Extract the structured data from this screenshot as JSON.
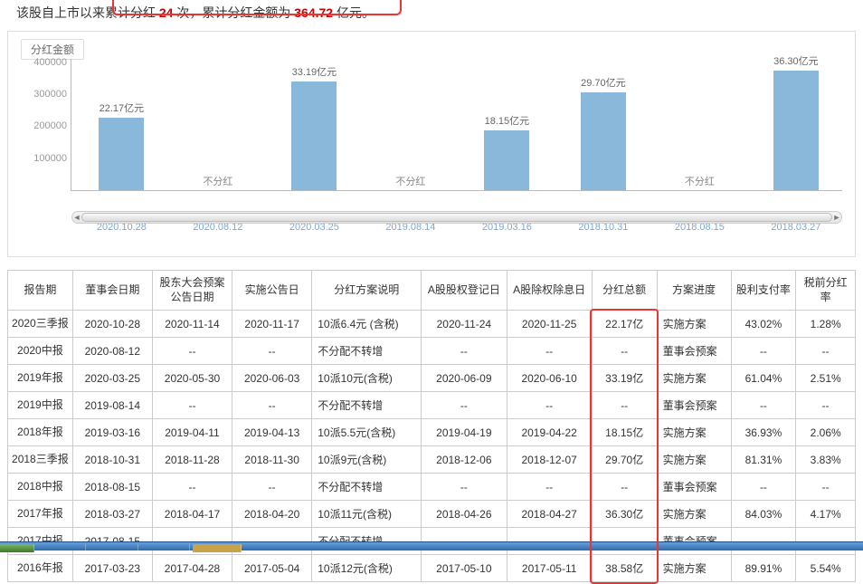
{
  "summary": {
    "prefix": "该股自上市以来累计分红 ",
    "count": "24",
    "mid": " 次，累计分红金额为 ",
    "total": "364.72",
    "suffix": " 亿元。"
  },
  "chart_data": {
    "type": "bar",
    "title": "分红金额",
    "ylabel": "",
    "ylim": [
      0,
      400000
    ],
    "yticks": [
      100000,
      200000,
      300000,
      400000
    ],
    "categories": [
      "2020.10.28",
      "2020.08.12",
      "2020.03.25",
      "2019.08.14",
      "2019.03.16",
      "2018.10.31",
      "2018.08.15",
      "2018.03.27"
    ],
    "values_label": [
      "22.17亿元",
      null,
      "33.19亿元",
      null,
      "18.15亿元",
      "29.70亿元",
      null,
      "36.30亿元"
    ],
    "values": [
      221700,
      null,
      331900,
      null,
      181500,
      297000,
      null,
      363000
    ],
    "no_dividend_label": "不分红"
  },
  "table": {
    "headers": [
      "报告期",
      "董事会日期",
      "股东大会预案公告日期",
      "实施公告日",
      "分红方案说明",
      "A股股权登记日",
      "A股除权除息日",
      "分红总额",
      "方案进度",
      "股利支付率",
      "税前分红率"
    ],
    "rows": [
      [
        "2020三季报",
        "2020-10-28",
        "2020-11-14",
        "2020-11-17",
        "10派6.4元 (含税)",
        "2020-11-24",
        "2020-11-25",
        "22.17亿",
        "实施方案",
        "43.02%",
        "1.28%"
      ],
      [
        "2020中报",
        "2020-08-12",
        "--",
        "--",
        "不分配不转增",
        "--",
        "--",
        "--",
        "董事会预案",
        "--",
        "--"
      ],
      [
        "2019年报",
        "2020-03-25",
        "2020-05-30",
        "2020-06-03",
        "10派10元(含税)",
        "2020-06-09",
        "2020-06-10",
        "33.19亿",
        "实施方案",
        "61.04%",
        "2.51%"
      ],
      [
        "2019中报",
        "2019-08-14",
        "--",
        "--",
        "不分配不转增",
        "--",
        "--",
        "--",
        "董事会预案",
        "--",
        "--"
      ],
      [
        "2018年报",
        "2019-03-16",
        "2019-04-11",
        "2019-04-13",
        "10派5.5元(含税)",
        "2019-04-19",
        "2019-04-22",
        "18.15亿",
        "实施方案",
        "36.93%",
        "2.06%"
      ],
      [
        "2018三季报",
        "2018-10-31",
        "2018-11-28",
        "2018-11-30",
        "10派9元(含税)",
        "2018-12-06",
        "2018-12-07",
        "29.70亿",
        "实施方案",
        "81.31%",
        "3.83%"
      ],
      [
        "2018中报",
        "2018-08-15",
        "--",
        "--",
        "不分配不转增",
        "--",
        "--",
        "--",
        "董事会预案",
        "--",
        "--"
      ],
      [
        "2017年报",
        "2018-03-27",
        "2018-04-17",
        "2018-04-20",
        "10派11元(含税)",
        "2018-04-26",
        "2018-04-27",
        "36.30亿",
        "实施方案",
        "84.03%",
        "4.17%"
      ],
      [
        "2017中报",
        "2017-08-15",
        "--",
        "--",
        "不分配不转增",
        "--",
        "--",
        "--",
        "董事会预案",
        "--",
        "--"
      ],
      [
        "2016年报",
        "2017-03-23",
        "2017-04-28",
        "2017-05-04",
        "10派12元(含税)",
        "2017-05-10",
        "2017-05-11",
        "38.58亿",
        "实施方案",
        "89.91%",
        "5.54%"
      ]
    ]
  }
}
